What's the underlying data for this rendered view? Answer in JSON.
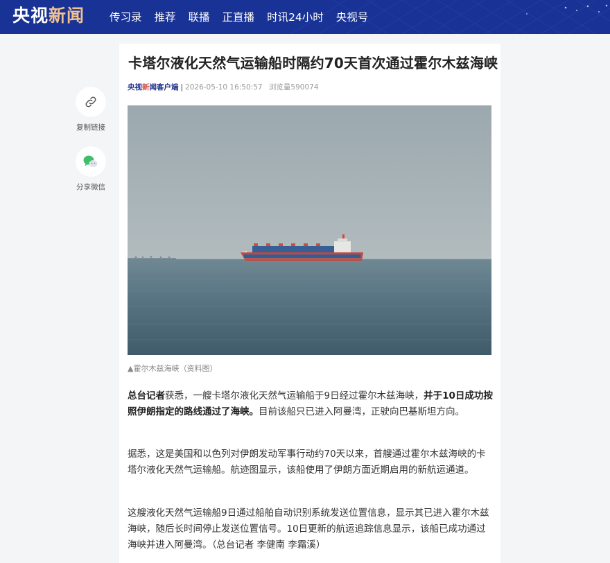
{
  "header": {
    "logo_part1": "央视",
    "logo_part2": "新闻",
    "nav": [
      "传习录",
      "推荐",
      "联播",
      "正直播",
      "时讯24小时",
      "央视号"
    ]
  },
  "share": {
    "copy_link_label": "复制链接",
    "wechat_label": "分享微信"
  },
  "article": {
    "title": "卡塔尔液化天然气运输船时隔约70天首次通过霍尔木兹海峡",
    "source_part1": "央视",
    "source_part2": "新",
    "source_part3": "闻客户端",
    "separator": "|",
    "datetime": "2026-05-10 16:50:57",
    "views_label": "浏览量",
    "views_count": "590074",
    "image_caption": "▲霍尔木兹海峡（资料图）",
    "p1_lead": "总台记者",
    "p1_a": "获悉，一艘卡塔尔液化天然气运输船于9日经过霍尔木兹海峡，",
    "p1_bold": "并于10日成功按照伊朗指定的路线通过了海峡。",
    "p1_b": "目前该船只已进入阿曼湾，正驶向巴基斯坦方向。",
    "p2": "据悉，这是美国和以色列对伊朗发动军事行动约70天以来，首艘通过霍尔木兹海峡的卡塔尔液化天然气运输船。航迹图显示，该船使用了伊朗方面近期启用的新航运通道。",
    "p3": "这艘液化天然气运输船9日通过船舶自动识别系统发送位置信息，显示其已进入霍尔木兹海峡，随后长时间停止发送位置信号。10日更新的航运追踪信息显示，该船已成功通过海峡并进入阿曼湾。（总台记者 李健南 李霜溪）"
  },
  "colors": {
    "header_bg": "#183295",
    "logo_accent": "#f0c290",
    "source_accent": "#d0504a"
  }
}
